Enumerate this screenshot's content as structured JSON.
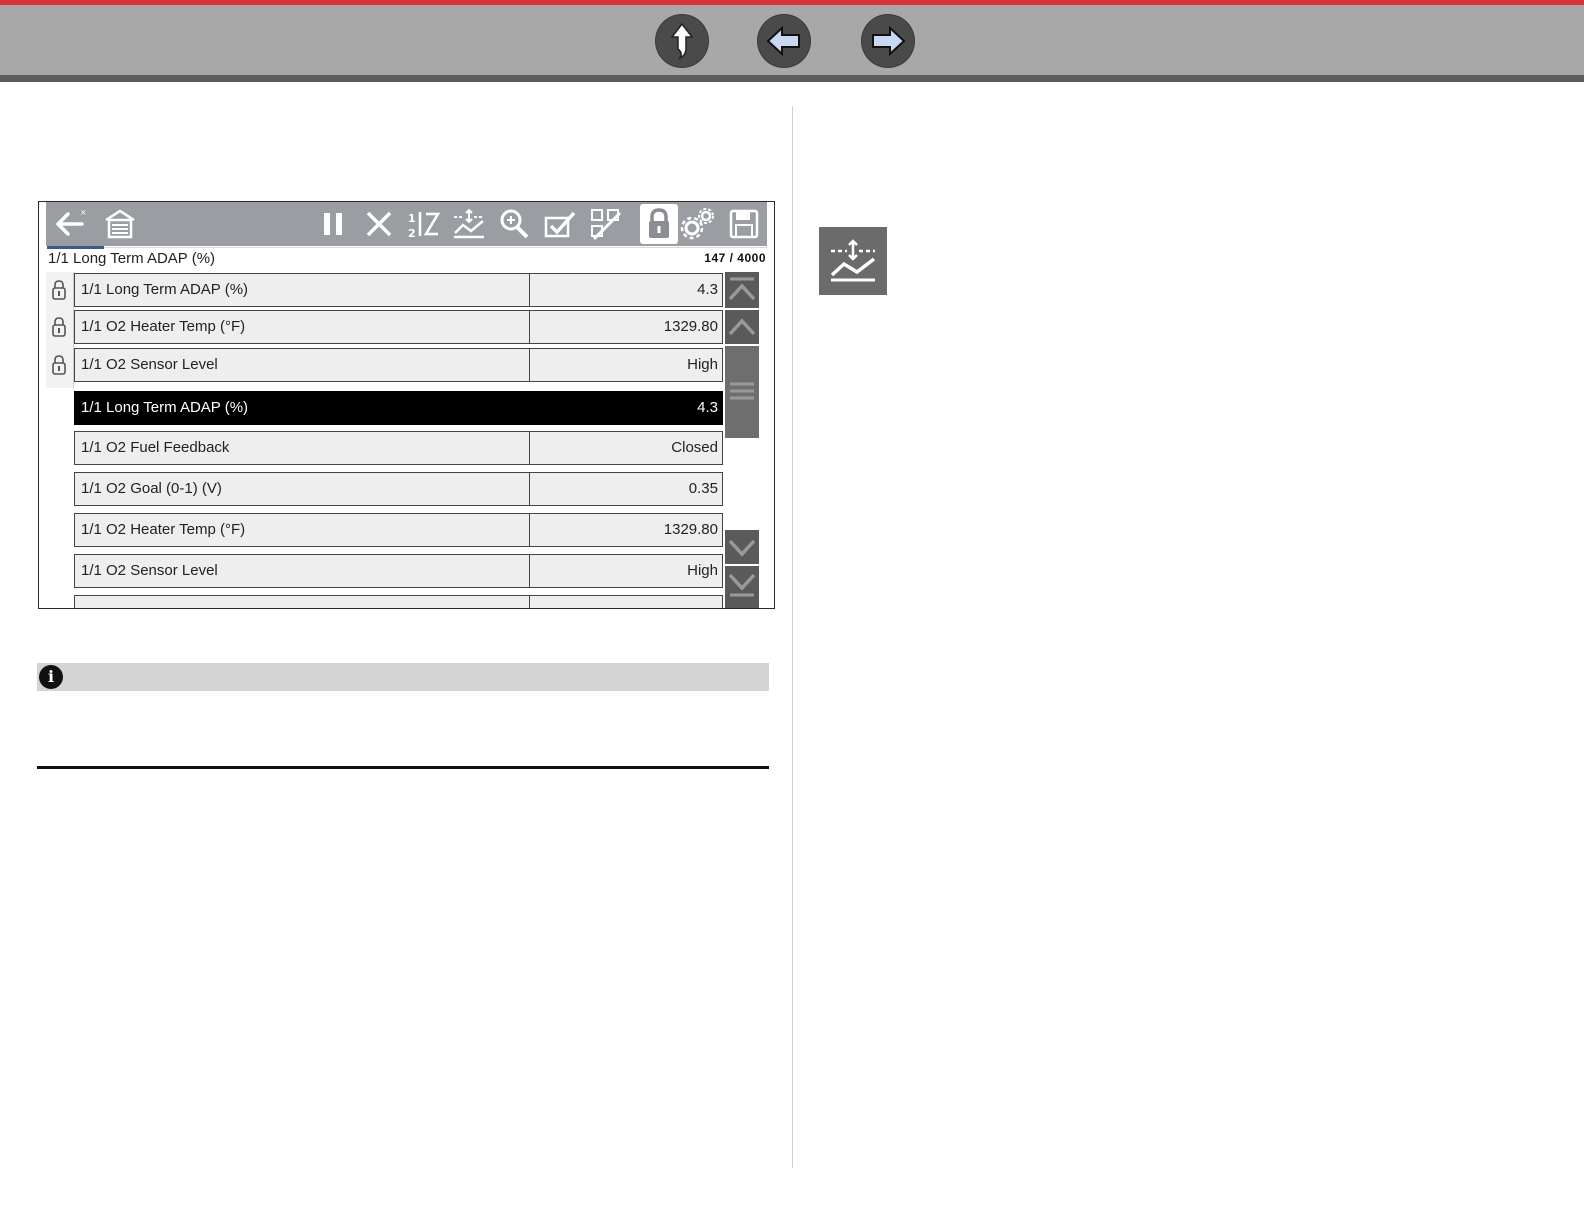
{
  "nav": {
    "up_icon": "up-arrow-icon",
    "back_icon": "back-arrow-icon",
    "forward_icon": "forward-arrow-icon",
    "accent_color": "#d8343c"
  },
  "screen": {
    "toolbar_icons": [
      "back-icon",
      "home-icon",
      "pause-icon",
      "close-icon",
      "sort-icon",
      "graph-scale-icon",
      "zoom-icon",
      "select-icon",
      "preview-icon",
      "lock-icon",
      "settings-icon",
      "save-icon"
    ],
    "title": "1/1 Long Term ADAP (%)",
    "count": "147 / 4000",
    "locked_rows": [
      {
        "label": "1/1 Long Term ADAP (%)",
        "value": "4.3"
      },
      {
        "label": "1/1 O2 Heater Temp (°F)",
        "value": "1329.80"
      },
      {
        "label": "1/1 O2 Sensor Level",
        "value": "High"
      }
    ],
    "rows": [
      {
        "label": "1/1 Long Term ADAP (%)",
        "value": "4.3",
        "selected": true
      },
      {
        "label": "1/1 O2 Fuel Feedback",
        "value": "Closed"
      },
      {
        "label": "1/1 O2 Goal (0-1) (V)",
        "value": "0.35"
      },
      {
        "label": "1/1 O2 Heater Temp (°F)",
        "value": "1329.80"
      },
      {
        "label": "1/1 O2 Sensor Level",
        "value": "High"
      }
    ]
  },
  "info": {
    "icon": "info-icon",
    "glyph": "i"
  },
  "right": {
    "icon": "graph-scale-icon"
  }
}
